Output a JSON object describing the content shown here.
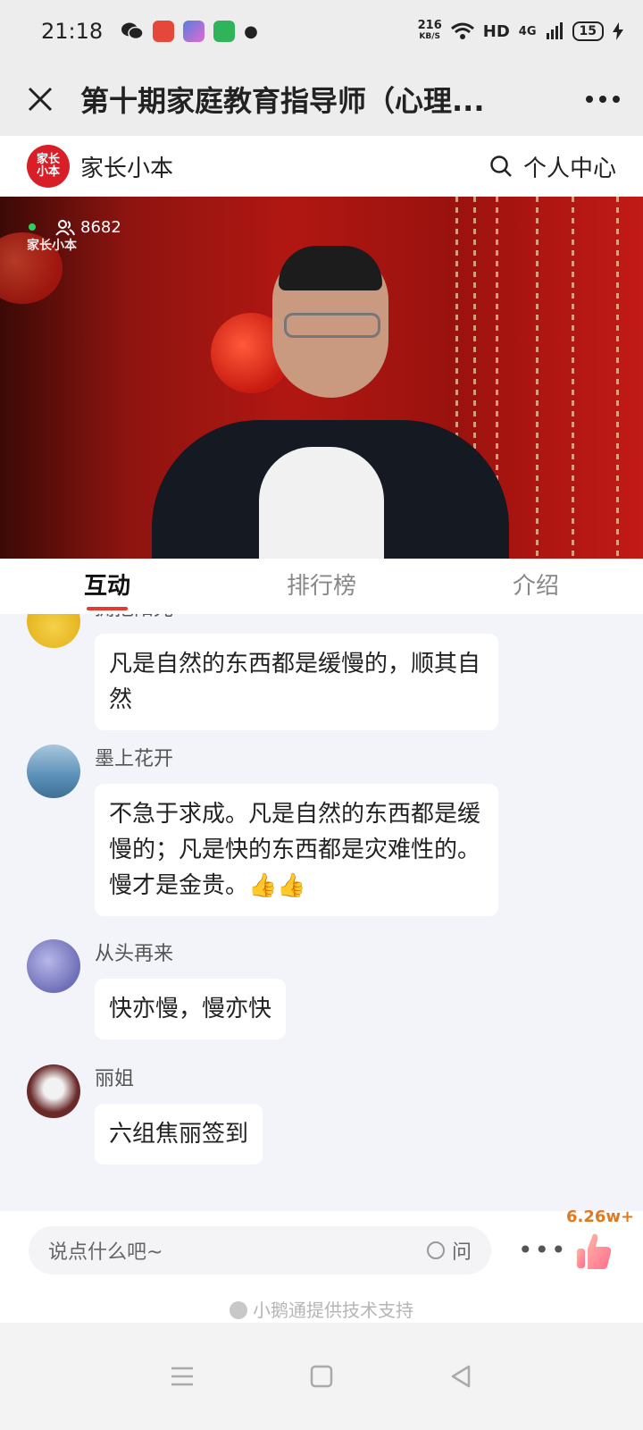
{
  "status_bar": {
    "time": "21:18",
    "network_speed_value": "216",
    "network_speed_unit": "KB/S",
    "hd_label": "HD",
    "network_type": "4G",
    "battery": "15"
  },
  "title_bar": {
    "title": "第十期家庭教育指导师（心理..."
  },
  "shop_bar": {
    "logo_text": "家长小本",
    "name": "家长小本",
    "personal_center": "个人中心"
  },
  "video": {
    "viewer_count": "8682",
    "watermark": "家长小本"
  },
  "tabs": [
    {
      "label": "互动",
      "active": true
    },
    {
      "label": "排行榜",
      "active": false
    },
    {
      "label": "介绍",
      "active": false
    }
  ],
  "messages": [
    {
      "nickname": "拥抱阳光",
      "text": "凡是自然的东西都是缓慢的，顺其自然",
      "avatar_color": "#e4b31c"
    },
    {
      "nickname": "墨上花开",
      "text": "不急于求成。凡是自然的东西都是缓慢的；凡是快的东西都是灾难性的。慢才是金贵。👍👍",
      "avatar_color": "#5a8fb8"
    },
    {
      "nickname": "从头再来",
      "text": "快亦慢，慢亦快",
      "avatar_color": "#6f6fb8"
    },
    {
      "nickname": "丽姐",
      "text": "六组焦丽签到",
      "avatar_color": "#6a2a2a"
    }
  ],
  "input_bar": {
    "placeholder": "说点什么吧~",
    "ask_label": "问",
    "like_count": "6.26w+"
  },
  "footer": {
    "support_text": "小鹅通提供技术支持"
  },
  "colors": {
    "accent": "#e8392e",
    "logo_red": "#d81e26",
    "like_orange": "#e07a22"
  }
}
